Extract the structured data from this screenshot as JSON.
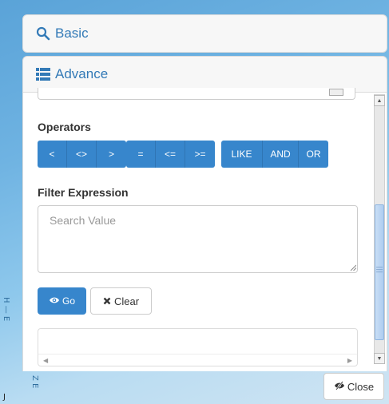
{
  "panels": {
    "basic_label": "Basic",
    "advance_label": "Advance"
  },
  "operators": {
    "label": "Operators",
    "group1": [
      "<",
      "<>",
      ">"
    ],
    "group2": [
      "=",
      "<=",
      ">="
    ],
    "group3": [
      "LIKE",
      "AND",
      "OR"
    ]
  },
  "filter": {
    "label": "Filter Expression",
    "placeholder": "Search Value"
  },
  "actions": {
    "go_label": "Go",
    "clear_label": "Clear",
    "close_label": "Close"
  },
  "colors": {
    "primary": "#3786cc",
    "link": "#337ab7"
  },
  "icons": {
    "basic": "search-icon",
    "advance": "list-icon",
    "go": "eye-icon",
    "clear": "x-icon",
    "close": "eye-slash-icon"
  }
}
